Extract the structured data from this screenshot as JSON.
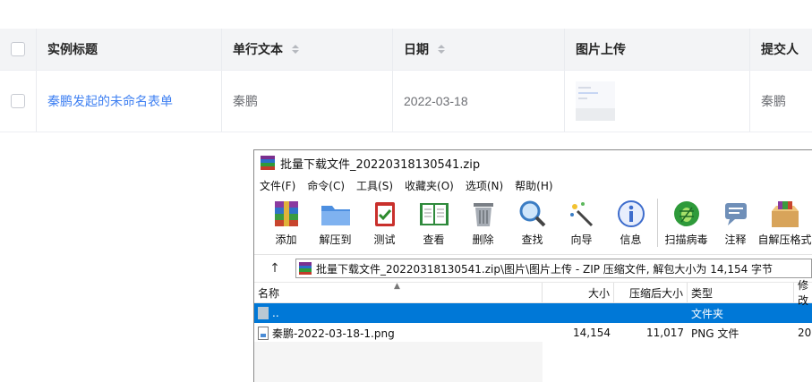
{
  "table": {
    "headers": [
      "实例标题",
      "单行文本",
      "日期",
      "图片上传",
      "提交人"
    ],
    "rows": [
      {
        "title": "秦鹏发起的未命名表单",
        "text": "秦鹏",
        "date": "2022-03-18",
        "submitter": "秦鹏"
      }
    ]
  },
  "winrar": {
    "title": "批量下载文件_20220318130541.zip",
    "menu": [
      "文件(F)",
      "命令(C)",
      "工具(S)",
      "收藏夹(O)",
      "选项(N)",
      "帮助(H)"
    ],
    "toolbar": [
      "添加",
      "解压到",
      "测试",
      "查看",
      "删除",
      "查找",
      "向导",
      "信息",
      "扫描病毒",
      "注释",
      "自解压格式"
    ],
    "address": "批量下载文件_20220318130541.zip\\图片\\图片上传 - ZIP 压缩文件, 解包大小为 14,154 字节",
    "columns": [
      "名称",
      "大小",
      "压缩后大小",
      "类型",
      "修改"
    ],
    "files": [
      {
        "name": "..",
        "size": "",
        "packed": "",
        "type": "文件夹",
        "modified": ""
      },
      {
        "name": "秦鹏-2022-03-18-1.png",
        "size": "14,154",
        "packed": "11,017",
        "type": "PNG 文件",
        "modified": "20"
      }
    ]
  }
}
